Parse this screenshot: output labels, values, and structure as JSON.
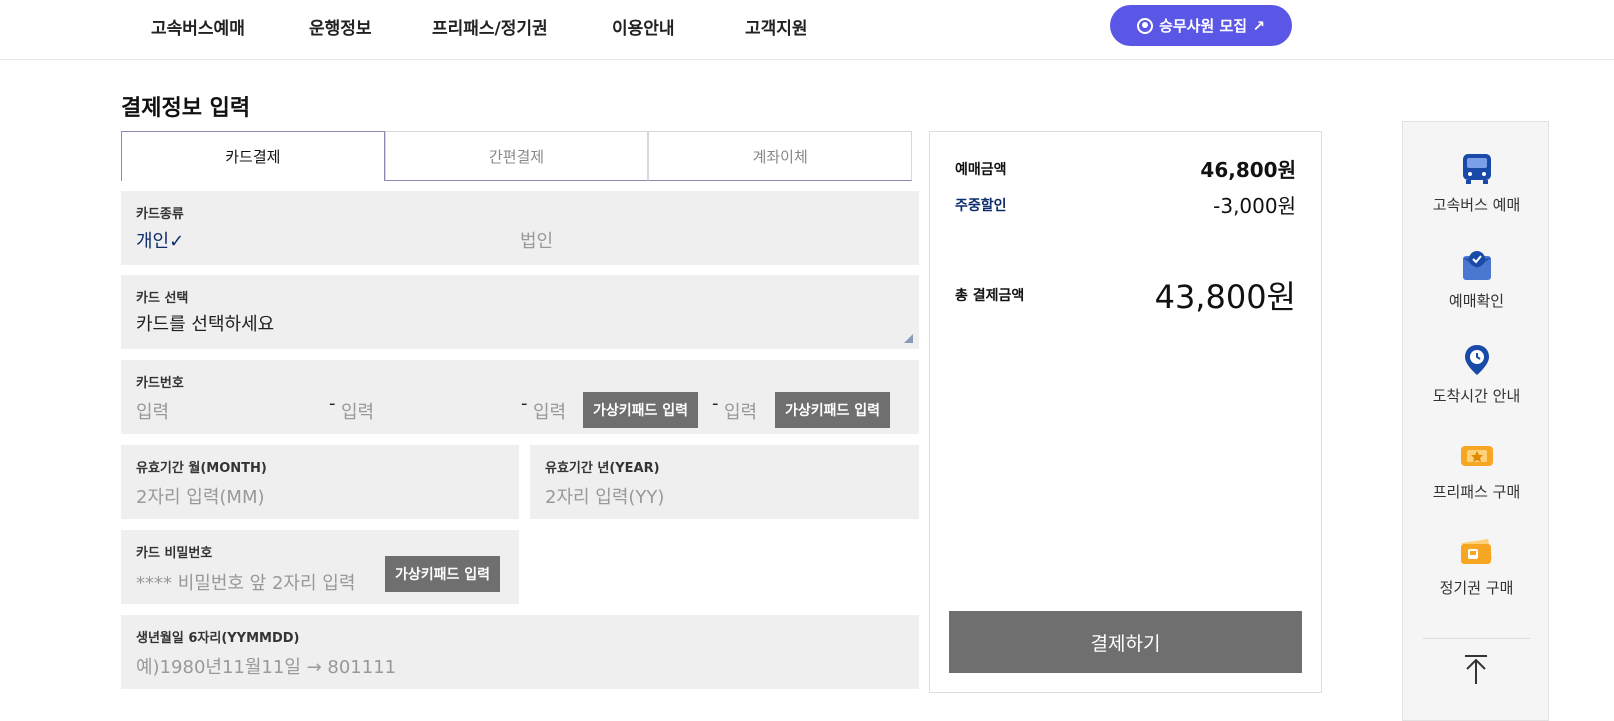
{
  "nav": {
    "items": [
      "고속버스예매",
      "운행정보",
      "프리패스/정기권",
      "이용안내",
      "고객지원"
    ],
    "recruit_label": "승무사원 모집 ↗"
  },
  "page_title": "결제정보 입력",
  "tabs": [
    "카드결제",
    "간편결제",
    "계좌이체"
  ],
  "card_type": {
    "label": "카드종류",
    "personal": "개인",
    "check": "✓",
    "corporate": "법인"
  },
  "card_select": {
    "label": "카드 선택",
    "value": "카드를 선택하세요"
  },
  "card_number": {
    "label": "카드번호",
    "placeholder": "입력",
    "dash": "-",
    "keypad_label": "가상키패드 입력"
  },
  "expiry_month": {
    "label": "유효기간 월(MONTH)",
    "placeholder": "2자리 입력(MM)"
  },
  "expiry_year": {
    "label": "유효기간 년(YEAR)",
    "placeholder": "2자리 입력(YY)"
  },
  "card_password": {
    "label": "카드 비밀번호",
    "placeholder": "**** 비밀번호 앞 2자리 입력",
    "keypad_label": "가상키패드 입력"
  },
  "birth": {
    "label": "생년월일 6자리(YYMMDD)",
    "placeholder": "예)1980년11월11일 → 801111"
  },
  "summary": {
    "booking_label": "예매금액",
    "booking_value": "46,800원",
    "discount_label": "주중할인",
    "discount_value": "-3,000원",
    "total_label": "총 결제금액",
    "total_value": "43,800원",
    "pay_label": "결제하기"
  },
  "quick_menu": [
    "고속버스 예매",
    "예매확인",
    "도착시간 안내",
    "프리패스 구매",
    "정기권 구매"
  ],
  "colors": {
    "accent": "#5a56e6",
    "navy": "#0d2c6b",
    "icon_blue": "#1a4aa8",
    "icon_orange": "#f6a623",
    "button_gray": "#6f6f6f"
  }
}
